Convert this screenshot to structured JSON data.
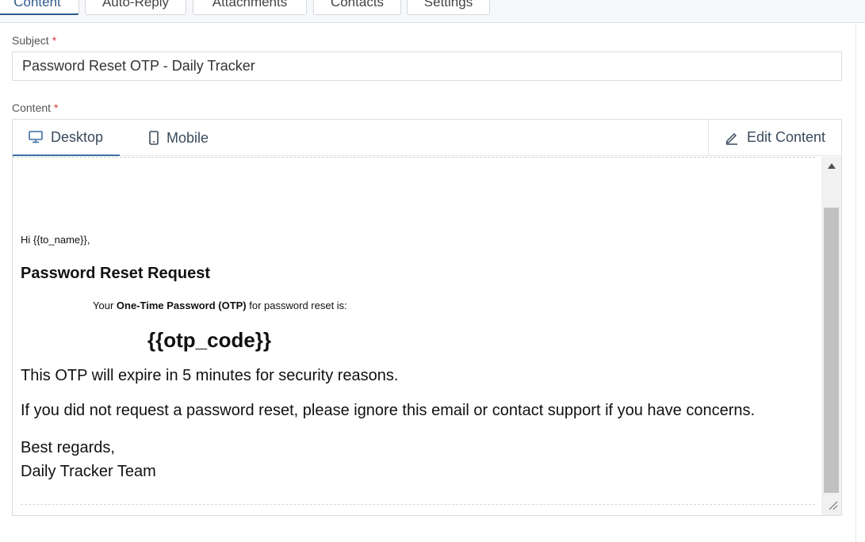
{
  "tabs": [
    {
      "label": "Content",
      "active": true
    },
    {
      "label": "Auto-Reply",
      "active": false
    },
    {
      "label": "Attachments",
      "active": false
    },
    {
      "label": "Contacts",
      "active": false
    },
    {
      "label": "Settings",
      "active": false
    }
  ],
  "subject": {
    "label": "Subject",
    "required_mark": "*",
    "value": "Password Reset OTP - Daily Tracker"
  },
  "content": {
    "label": "Content",
    "required_mark": "*"
  },
  "editor": {
    "modes": [
      {
        "label": "Desktop",
        "icon": "desktop-icon",
        "active": true
      },
      {
        "label": "Mobile",
        "icon": "mobile-icon",
        "active": false
      }
    ],
    "edit_label": "Edit Content",
    "edit_icon": "pencil-icon"
  },
  "email": {
    "greeting": "Hi {{to_name}},",
    "heading": "Password Reset Request",
    "otp_prefix": "Your ",
    "otp_bold": "One-Time Password (OTP)",
    "otp_suffix": " for password reset is:",
    "otp_code": "{{otp_code}}",
    "p1": "This OTP will expire in 5 minutes for security reasons.",
    "p2": "If you did not request a password reset, please ignore this email or contact support if you have concerns.",
    "signoff": "Best regards,",
    "signature": "Daily Tracker Team"
  },
  "colors": {
    "accent": "#2d5a8c",
    "required": "#d9363e"
  }
}
